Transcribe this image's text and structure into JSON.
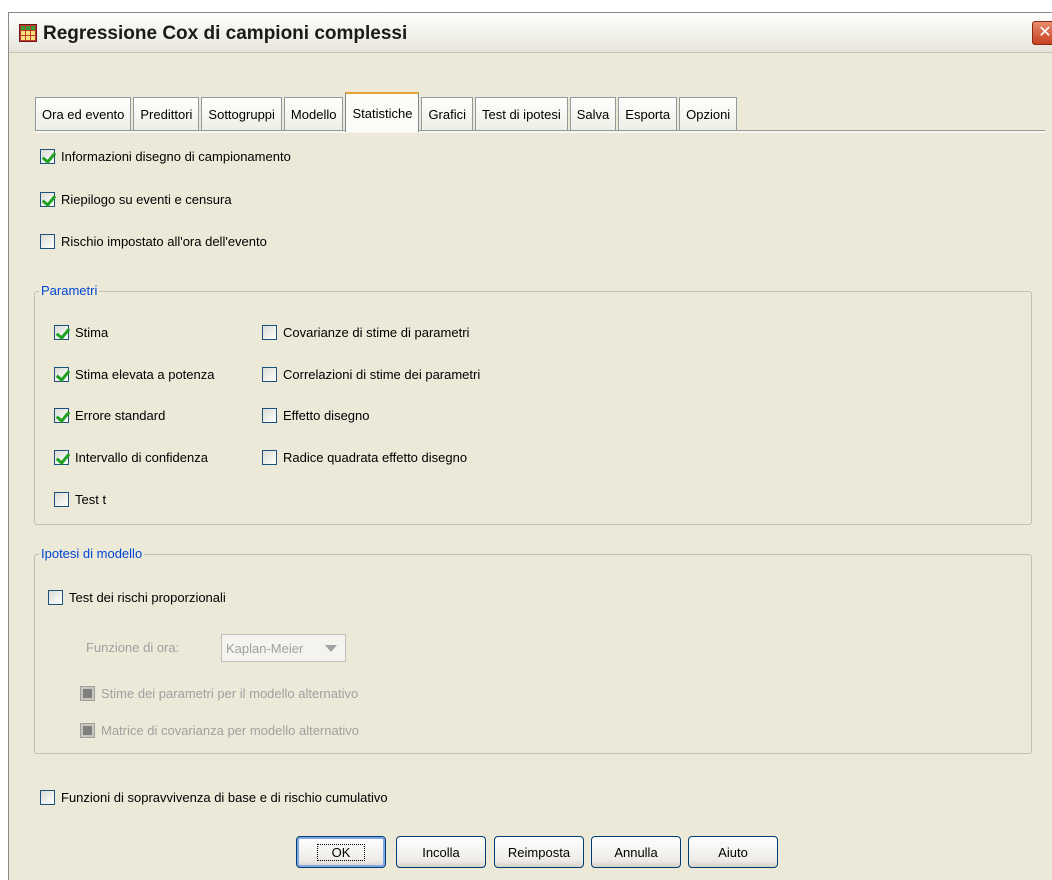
{
  "window": {
    "title": "Regressione Cox di campioni complessi",
    "close_glyph": "✕"
  },
  "tabs": [
    {
      "label": "Ora ed evento",
      "active": false
    },
    {
      "label": "Predittori",
      "active": false
    },
    {
      "label": "Sottogruppi",
      "active": false
    },
    {
      "label": "Modello",
      "active": false
    },
    {
      "label": "Statistiche",
      "active": true
    },
    {
      "label": "Grafici",
      "active": false
    },
    {
      "label": "Test di ipotesi",
      "active": false
    },
    {
      "label": "Salva",
      "active": false
    },
    {
      "label": "Esporta",
      "active": false
    },
    {
      "label": "Opzioni",
      "active": false
    }
  ],
  "top_checks": {
    "sampling_info": {
      "label": "Informazioni disegno di campionamento",
      "checked": true
    },
    "event_summary": {
      "label": "Riepilogo su eventi e censura",
      "checked": true
    },
    "risk_set": {
      "label": "Rischio impostato all'ora dell'evento",
      "checked": false
    }
  },
  "parametri": {
    "title": "Parametri",
    "estimate": {
      "label": "Stima",
      "checked": true
    },
    "exp_estimate": {
      "label": "Stima elevata a potenza",
      "checked": true
    },
    "std_error": {
      "label": "Errore standard",
      "checked": true
    },
    "conf_interval": {
      "label": "Intervallo di confidenza",
      "checked": true
    },
    "t_test": {
      "label": "Test t",
      "checked": false
    },
    "covariances": {
      "label": "Covarianze di stime di parametri",
      "checked": false
    },
    "correlations": {
      "label": "Correlazioni di stime dei parametri",
      "checked": false
    },
    "design_effect": {
      "label": "Effetto disegno",
      "checked": false
    },
    "sqrt_design_effect": {
      "label": "Radice quadrata effetto disegno",
      "checked": false
    }
  },
  "ipotesi": {
    "title": "Ipotesi di modello",
    "prop_hazards": {
      "label": "Test dei rischi proporzionali",
      "checked": false
    },
    "time_function_label": "Funzione di ora:",
    "time_function_value": "Kaplan-Meier",
    "alt_estimates": {
      "label": "Stime dei parametri per il modello alternativo"
    },
    "alt_covariance": {
      "label": "Matrice di covarianza per modello alternativo"
    }
  },
  "baseline": {
    "label": "Funzioni di sopravvivenza di base e di rischio cumulativo",
    "checked": false
  },
  "buttons": {
    "ok": "OK",
    "paste": "Incolla",
    "reset": "Reimposta",
    "cancel": "Annulla",
    "help": "Aiuto"
  }
}
